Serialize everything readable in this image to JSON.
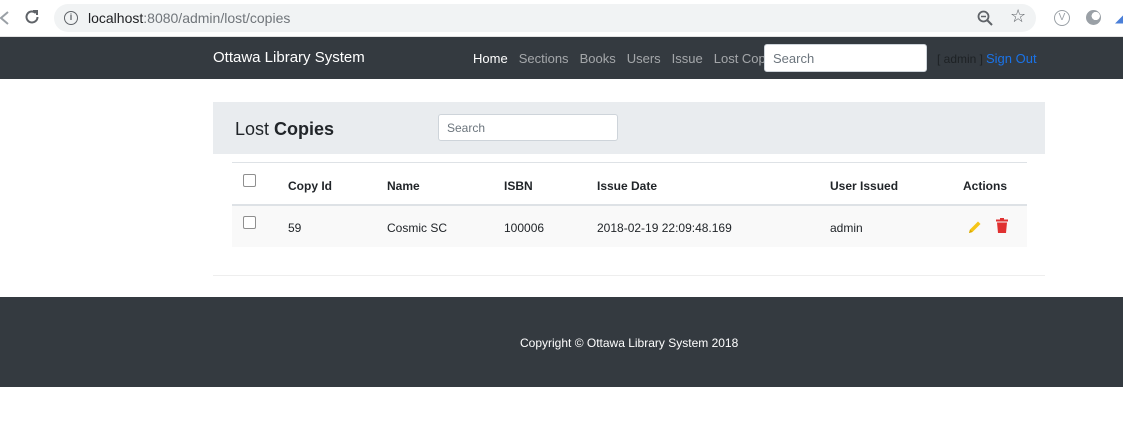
{
  "browser": {
    "url_host": "localhost",
    "url_path": ":8080/admin/lost/copies",
    "icons": [
      "back-arrow-icon",
      "reload-icon",
      "info-icon",
      "zoom-icon",
      "star-icon",
      "extension-icon"
    ]
  },
  "navbar": {
    "brand": "Ottawa Library System",
    "links": [
      {
        "label": "Home",
        "active": true
      },
      {
        "label": "Sections",
        "active": false
      },
      {
        "label": "Books",
        "active": false
      },
      {
        "label": "Users",
        "active": false
      },
      {
        "label": "Issue",
        "active": false
      },
      {
        "label": "Lost Copies",
        "active": false
      }
    ],
    "search_placeholder": "Search",
    "user_label": "[ admin ]",
    "signout_label": "Sign Out"
  },
  "page": {
    "title_lost": "Lost",
    "title_copies": "Copies",
    "search_placeholder": "Search"
  },
  "table": {
    "headers": [
      "Copy Id",
      "Name",
      "ISBN",
      "Issue Date",
      "User Issued",
      "Actions"
    ],
    "rows": [
      {
        "copy_id": "59",
        "name": "Cosmic SC",
        "isbn": "100006",
        "issue_date": "2018-02-19 22:09:48.169",
        "user_issued": "admin"
      }
    ]
  },
  "footer": {
    "copyright": "Copyright © Ottawa Library System 2018"
  },
  "colors": {
    "navbar_bg": "#343a40",
    "header_bg": "#e9ecef",
    "edit_icon": "#f5c518",
    "delete_icon": "#e03131",
    "signout": "#1a73e8"
  }
}
